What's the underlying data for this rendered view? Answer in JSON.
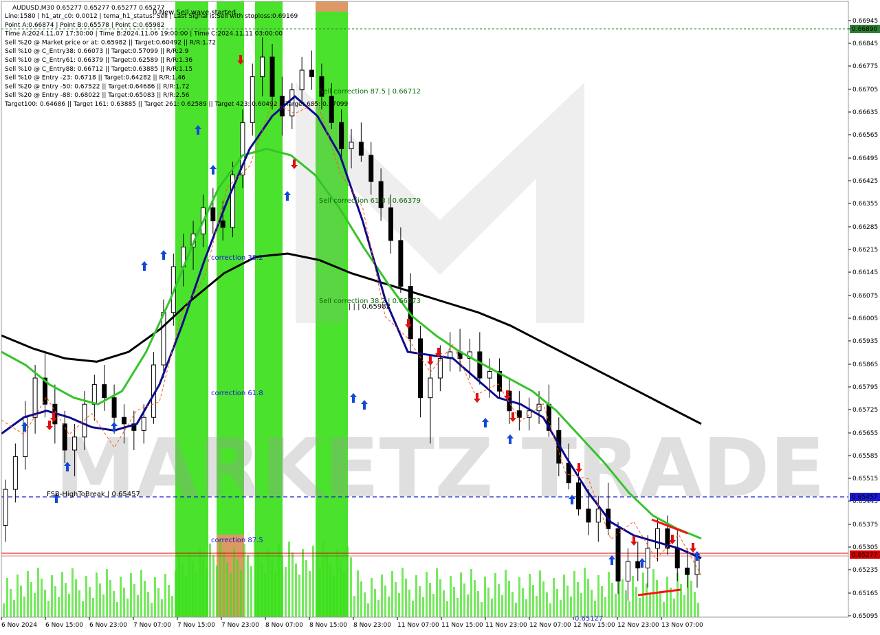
{
  "chart_data": {
    "type": "candlestick",
    "symbol_line": "AUDUSD,M30  0.65277 0.65277 0.65277 0.65277",
    "top_message": "0 New Sell wave started",
    "info_lines": [
      "Line:1580  |  h1_atr_c0: 0.0012  |  tema_h1_status: Sell  |  Last Signal is:Sell with stoploss:0.69169",
      "Point A:0.66874  |  Point B:0.65578  |  Point C:0.65982",
      "Time A:2024.11.07 17:30:00  |  Time B:2024.11.06 19:00:00  |  Time C:2024.11.11 03:00:00",
      "Sell %20 @ Market price or at: 0.65982  ||  Target:0.60492  ||  R/R:1.72",
      "Sell %10 @ C_Entry38: 0.66073  ||  Target:0.57099  ||  R/R:2.9",
      "Sell %10 @ C_Entry61: 0.66379  ||  Target:0.62589  ||  R/R:1.36",
      "Sell %10 @ C_Entry88: 0.66712  ||  Target:0.63885  ||  R/R:1.15",
      "Sell %10 @ Entry -23: 0.6718  ||  Target:0.64282  ||  R/R:1.46",
      "Sell %20 @ Entry -50: 0.67522  ||  Target:0.64686  ||  R/R:1.72",
      "Sell %20 @ Entry -88: 0.68022  ||  Target:0.65083  ||  R/R:2.56",
      "Target100: 0.64686  ||  Target 161: 0.63885  ||  Target 261: 0.62589  ||  Target 423: 0.60492  ||  Target 685: 0.57099"
    ],
    "x_labels": [
      "6 Nov 2024",
      "6 Nov 15:00",
      "6 Nov 23:00",
      "7 Nov 07:00",
      "7 Nov 15:00",
      "7 Nov 23:00",
      "8 Nov 07:00",
      "8 Nov 15:00",
      "8 Nov 23:00",
      "11 Nov 07:00",
      "11 Nov 15:00",
      "11 Nov 23:00",
      "12 Nov 07:00",
      "12 Nov 15:00",
      "12 Nov 23:00",
      "13 Nov 07:00"
    ],
    "y_labels": [
      "0.66945",
      "0.66890",
      "0.66845",
      "0.66775",
      "0.66705",
      "0.66635",
      "0.66565",
      "0.66495",
      "0.66425",
      "0.66355",
      "0.66285",
      "0.66215",
      "0.66145",
      "0.66075",
      "0.66005",
      "0.65935",
      "0.65865",
      "0.65795",
      "0.65725",
      "0.65655",
      "0.65585",
      "0.65515",
      "0.65445",
      "0.65375",
      "0.65305",
      "0.65235",
      "0.65165",
      "0.65095"
    ],
    "y_range": [
      0.6509,
      0.6697
    ],
    "highlighted_levels": [
      {
        "value": "0.66890",
        "color": "#2e7d32"
      },
      {
        "value": "0.65457",
        "color": "#1a1ad6"
      },
      {
        "value": "0.65277",
        "color": "#d40000"
      }
    ],
    "annotations": [
      "Sell correction 87.5 | 0.66712",
      "Sell correction 61.8 | 0.66379",
      "Sell correction 38.2 | 0.66073",
      "| | | 0.65982",
      "correction 38.2",
      "correction 61.8",
      "correction 87.5",
      "FSB-HighToBreak | 0.65457",
      "0.65127"
    ],
    "watermark": "MARKETZ TRADE",
    "candles_ohlc": [
      [
        0.6537,
        0.6551,
        0.6532,
        0.6548
      ],
      [
        0.6548,
        0.6562,
        0.6544,
        0.6558
      ],
      [
        0.6558,
        0.6575,
        0.6554,
        0.657
      ],
      [
        0.657,
        0.6586,
        0.6565,
        0.6582
      ],
      [
        0.6582,
        0.659,
        0.657,
        0.6574
      ],
      [
        0.6574,
        0.658,
        0.6562,
        0.6568
      ],
      [
        0.6568,
        0.6572,
        0.6556,
        0.656
      ],
      [
        0.656,
        0.6568,
        0.6552,
        0.6564
      ],
      [
        0.6564,
        0.6578,
        0.656,
        0.6574
      ],
      [
        0.6574,
        0.6583,
        0.6569,
        0.658
      ],
      [
        0.658,
        0.6586,
        0.6572,
        0.6576
      ],
      [
        0.6576,
        0.658,
        0.6565,
        0.657
      ],
      [
        0.657,
        0.6574,
        0.6562,
        0.6568
      ],
      [
        0.6568,
        0.6572,
        0.656,
        0.6566
      ],
      [
        0.6566,
        0.6574,
        0.6562,
        0.657
      ],
      [
        0.657,
        0.659,
        0.6568,
        0.6586
      ],
      [
        0.6586,
        0.6606,
        0.6582,
        0.6602
      ],
      [
        0.6602,
        0.662,
        0.6598,
        0.6616
      ],
      [
        0.6616,
        0.6626,
        0.661,
        0.6622
      ],
      [
        0.6622,
        0.663,
        0.6615,
        0.6626
      ],
      [
        0.6626,
        0.6638,
        0.6622,
        0.6634
      ],
      [
        0.6634,
        0.664,
        0.6626,
        0.663
      ],
      [
        0.663,
        0.6636,
        0.6624,
        0.6628
      ],
      [
        0.6628,
        0.6648,
        0.6625,
        0.6644
      ],
      [
        0.6644,
        0.6664,
        0.664,
        0.666
      ],
      [
        0.666,
        0.6678,
        0.6656,
        0.6674
      ],
      [
        0.6674,
        0.6686,
        0.6668,
        0.668
      ],
      [
        0.668,
        0.6684,
        0.6664,
        0.6668
      ],
      [
        0.6668,
        0.6674,
        0.6656,
        0.6662
      ],
      [
        0.6662,
        0.6672,
        0.6658,
        0.667
      ],
      [
        0.667,
        0.668,
        0.6666,
        0.6676
      ],
      [
        0.6676,
        0.6682,
        0.667,
        0.6674
      ],
      [
        0.6674,
        0.6678,
        0.6664,
        0.6668
      ],
      [
        0.6668,
        0.6672,
        0.6658,
        0.666
      ],
      [
        0.666,
        0.6664,
        0.6648,
        0.6652
      ],
      [
        0.6652,
        0.6658,
        0.6646,
        0.6654
      ],
      [
        0.6654,
        0.666,
        0.6648,
        0.665
      ],
      [
        0.665,
        0.6654,
        0.6638,
        0.6642
      ],
      [
        0.6642,
        0.6646,
        0.663,
        0.6634
      ],
      [
        0.6634,
        0.6638,
        0.662,
        0.6624
      ],
      [
        0.6624,
        0.6628,
        0.6608,
        0.661
      ],
      [
        0.661,
        0.6614,
        0.659,
        0.6594
      ],
      [
        0.6594,
        0.6598,
        0.657,
        0.6576
      ],
      [
        0.6576,
        0.6586,
        0.6562,
        0.6582
      ],
      [
        0.6582,
        0.6592,
        0.6578,
        0.6588
      ],
      [
        0.6588,
        0.6596,
        0.6584,
        0.659
      ],
      [
        0.659,
        0.6597,
        0.6584,
        0.6588
      ],
      [
        0.6588,
        0.6594,
        0.6582,
        0.659
      ],
      [
        0.659,
        0.6596,
        0.658,
        0.6582
      ],
      [
        0.6582,
        0.6588,
        0.6576,
        0.6584
      ],
      [
        0.6584,
        0.6588,
        0.6576,
        0.6578
      ],
      [
        0.6578,
        0.6582,
        0.6568,
        0.6572
      ],
      [
        0.6572,
        0.6578,
        0.6566,
        0.657
      ],
      [
        0.657,
        0.6576,
        0.6566,
        0.6572
      ],
      [
        0.6572,
        0.6578,
        0.6568,
        0.6574
      ],
      [
        0.6574,
        0.658,
        0.6564,
        0.6566
      ],
      [
        0.6566,
        0.657,
        0.6552,
        0.6556
      ],
      [
        0.6556,
        0.6562,
        0.6548,
        0.655
      ],
      [
        0.655,
        0.6556,
        0.654,
        0.6542
      ],
      [
        0.6542,
        0.6548,
        0.6534,
        0.6538
      ],
      [
        0.6538,
        0.6546,
        0.6532,
        0.6542
      ],
      [
        0.6542,
        0.655,
        0.6534,
        0.6536
      ],
      [
        0.6536,
        0.6538,
        0.6516,
        0.652
      ],
      [
        0.652,
        0.653,
        0.6514,
        0.6526
      ],
      [
        0.6526,
        0.6532,
        0.652,
        0.6524
      ],
      [
        0.6524,
        0.6534,
        0.6518,
        0.653
      ],
      [
        0.653,
        0.6539,
        0.6526,
        0.6536
      ],
      [
        0.6536,
        0.654,
        0.6528,
        0.653
      ],
      [
        0.653,
        0.6536,
        0.652,
        0.6524
      ],
      [
        0.6524,
        0.653,
        0.6518,
        0.6522
      ],
      [
        0.6522,
        0.6529,
        0.6518,
        0.65277
      ]
    ],
    "ma_blue": [
      0.6565,
      0.657,
      0.6572,
      0.657,
      0.6567,
      0.6566,
      0.6568,
      0.658,
      0.6598,
      0.6618,
      0.6636,
      0.6652,
      0.6662,
      0.6668,
      0.6662,
      0.665,
      0.663,
      0.6606,
      0.659,
      0.6589,
      0.6588,
      0.6582,
      0.6576,
      0.6574,
      0.657,
      0.6558,
      0.6547,
      0.6538,
      0.6534,
      0.6532,
      0.653,
      0.6527
    ],
    "ma_green": [
      0.659,
      0.6586,
      0.658,
      0.6576,
      0.6574,
      0.6578,
      0.659,
      0.6606,
      0.6624,
      0.664,
      0.665,
      0.6652,
      0.665,
      0.6644,
      0.6634,
      0.6622,
      0.6611,
      0.6601,
      0.6595,
      0.659,
      0.6586,
      0.6582,
      0.6578,
      0.6572,
      0.6564,
      0.6556,
      0.6547,
      0.654,
      0.6536,
      0.6533
    ],
    "ma_black": [
      0.6595,
      0.6591,
      0.6588,
      0.6587,
      0.659,
      0.6597,
      0.6606,
      0.6614,
      0.6619,
      0.662,
      0.6618,
      0.6614,
      0.6611,
      0.6608,
      0.6605,
      0.6602,
      0.6598,
      0.6593,
      0.6588,
      0.6583,
      0.6578,
      0.6573,
      0.6568
    ]
  }
}
